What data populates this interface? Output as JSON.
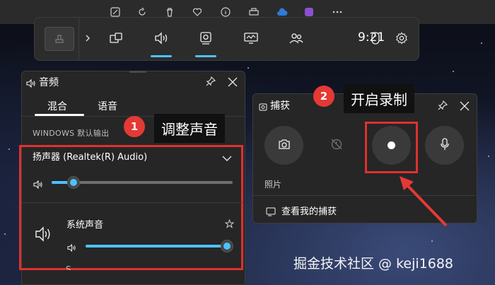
{
  "game_bar": {
    "time": "9:21",
    "widgets": [
      "widget-menu-icon",
      "performance-icon",
      "audio-icon",
      "capture-icon",
      "resources-icon",
      "social-icon"
    ],
    "active_widgets": [
      "audio-icon",
      "capture-icon"
    ]
  },
  "audio": {
    "title": "音频",
    "tabs": [
      {
        "label": "混合",
        "active": true
      },
      {
        "label": "语音",
        "active": false
      }
    ],
    "output_label": "WINDOWS 默认输出",
    "device_name": "扬声器 (Realtek(R) Audio)",
    "device_volume": 0.12,
    "app_name": "系统声音",
    "app_volume": 0.98,
    "partial_next_item": "S..."
  },
  "capture": {
    "title": "捕获",
    "photo_label": "照片",
    "view_captures_link": "查看我的捕获"
  },
  "annotations": {
    "callout1_num": "1",
    "callout1_text": "调整声音",
    "callout2_num": "2",
    "callout2_text": "开启录制",
    "accent_red": "#e03030"
  },
  "watermark": "掘金技术社区 @ keji1688",
  "colors": {
    "accent": "#4cc2ff",
    "panel_bg": "#262626",
    "annotation_red": "#e03030"
  }
}
